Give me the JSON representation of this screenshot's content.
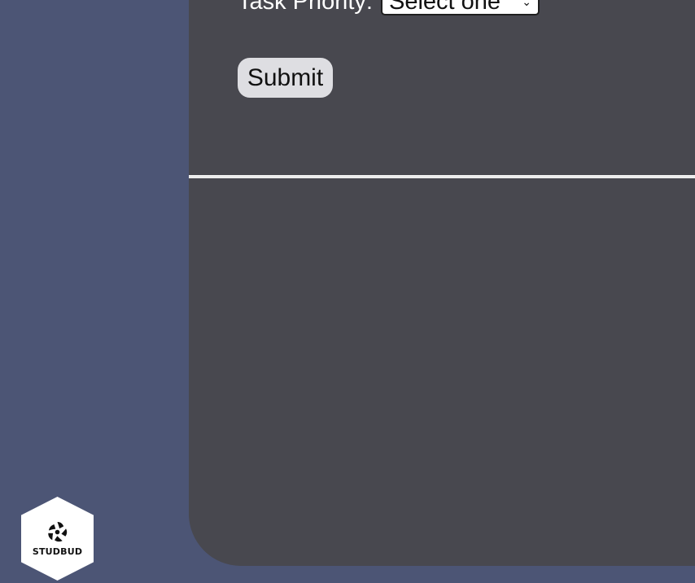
{
  "form": {
    "priority_label": "Task Priority:",
    "priority_selected": "Select one",
    "submit_label": "Submit"
  },
  "badge": {
    "logo_label": "STUDBUD",
    "logo_icon": "aperture-icon"
  },
  "colors": {
    "page_background": "#4c5575",
    "panel_background": "#48484f",
    "button_background": "#dedee2",
    "divider": "#ececec"
  }
}
